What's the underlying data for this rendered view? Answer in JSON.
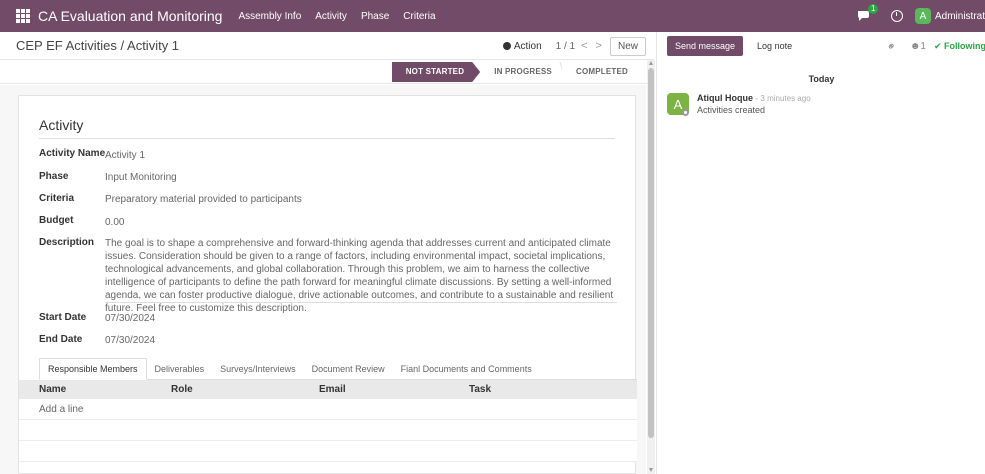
{
  "topbar": {
    "app_name": "CA Evaluation and Monitoring",
    "menu": [
      "Assembly Info",
      "Activity",
      "Phase",
      "Criteria"
    ],
    "chat_badge": "1",
    "user_initial": "A",
    "user_name": "Administrat"
  },
  "control": {
    "breadcrumb": "CEP EF Activities / Activity 1",
    "action_label": "Action",
    "pager": "1 / 1",
    "pager_prev": "<",
    "pager_next": ">",
    "new_label": "New"
  },
  "statusbar": {
    "stages": [
      "NOT STARTED",
      "IN PROGRESS",
      "COMPLETED"
    ],
    "active": "NOT STARTED"
  },
  "form": {
    "title": "Activity",
    "fields": {
      "activity_name_label": "Activity Name",
      "activity_name": "Activity 1",
      "phase_label": "Phase",
      "phase": "Input Monitoring",
      "criteria_label": "Criteria",
      "criteria": "Preparatory material provided to participants",
      "budget_label": "Budget",
      "budget": "0.00",
      "description_label": "Description",
      "description": "The goal is to shape a comprehensive and forward-thinking agenda that addresses current and anticipated climate issues. Consideration should be given to a range of factors, including environmental impact, societal implications, technological advancements, and global collaboration. Through this problem, we aim to harness the collective intelligence of participants to define the path forward for meaningful climate discussions. By setting a well-informed agenda, we can foster productive dialogue, drive actionable outcomes, and contribute to a sustainable and resilient future. Feel free to customize this description.",
      "start_date_label": "Start Date",
      "start_date": "07/30/2024",
      "end_date_label": "End Date",
      "end_date": "07/30/2024"
    },
    "tabs": [
      "Responsible Members",
      "Deliverables",
      "Surveys/Interviews",
      "Document Review",
      "Fianl Documents and Comments"
    ],
    "table": {
      "columns": [
        "Name",
        "Role",
        "Email",
        "Task"
      ],
      "add_line": "Add a line"
    }
  },
  "chatter": {
    "send_message": "Send message",
    "log_note": "Log note",
    "followers_count": "1",
    "following_label": "Following",
    "today_label": "Today",
    "message": {
      "avatar_initial": "A",
      "author": "Atiqul Hoque",
      "time": "- 3 minutes ago",
      "body": "Activities created"
    }
  },
  "colors": {
    "brand": "#714B67",
    "following": "#28a745"
  }
}
